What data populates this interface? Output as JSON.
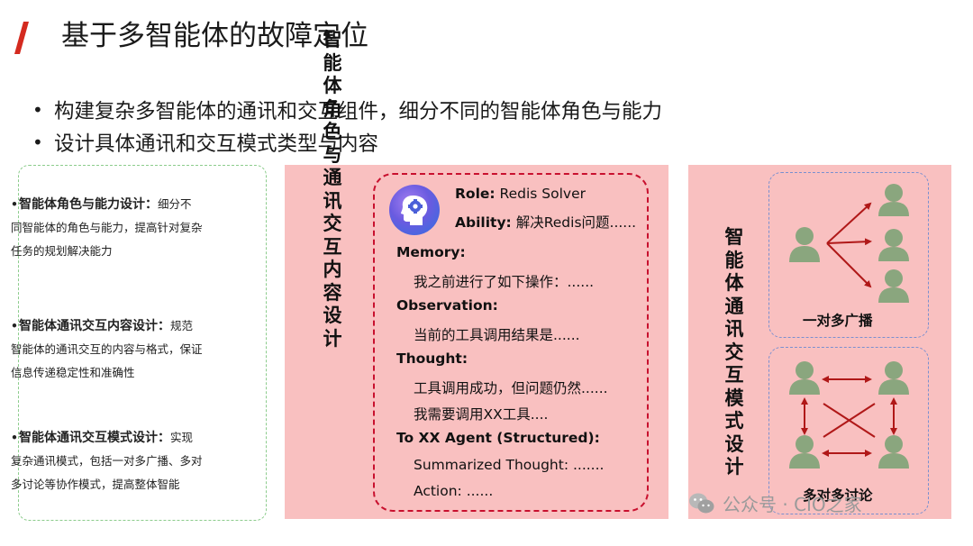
{
  "title": "基于多智能体的故障定位",
  "bullets": [
    "构建复杂多智能体的通讯和交互组件，细分不同的智能体角色与能力",
    "设计具体通讯和交互模式类型与内容"
  ],
  "left_panel": {
    "items": [
      {
        "lead": "智能体角色与能力设计：",
        "lines": [
          "细分不",
          "同智能体的角色与能力，提高针对复杂",
          "任务的规划解决能力"
        ]
      },
      {
        "lead": "智能体通讯交互内容设计：",
        "lines": [
          "规范",
          "智能体的通讯交互的内容与格式，保证",
          "信息传递稳定性和准确性"
        ]
      },
      {
        "lead": "智能体通讯交互模式设计：",
        "lines": [
          "实现",
          "复杂通讯模式，包括一对多广播、多对",
          "多讨论等协作模式，提高整体智能"
        ]
      }
    ]
  },
  "middle_panel": {
    "vertical_title": "智能体角色与通讯交互内容设计",
    "card": {
      "role_label": "Role:",
      "role_value": "Redis Solver",
      "ability_label": "Ability:",
      "ability_value": "解决Redis问题......",
      "memory_label": "Memory:",
      "memory_text": "我之前进行了如下操作：......",
      "observation_label": "Observation:",
      "observation_text": "当前的工具调用结果是......",
      "thought_label": "Thought:",
      "thought_line1": "工具调用成功，但问题仍然......",
      "thought_line2": "我需要调用XX工具....",
      "to_agent_label": "To XX Agent  (Structured):",
      "summary_text": "Summarized Thought: .......",
      "action_text": "Action: ......"
    }
  },
  "right_panel": {
    "vertical_title": "智能体通讯交互模式设计",
    "broadcast_label": "一对多广播",
    "discussion_label": "多对多讨论"
  },
  "watermark": "公众号 · CIO之家",
  "colors": {
    "accent": "#d42a1f",
    "panel_pink": "#f9c0c0",
    "card_border": "#c8102e",
    "person_green": "#8aa67e",
    "arrow_red": "#b01818"
  }
}
